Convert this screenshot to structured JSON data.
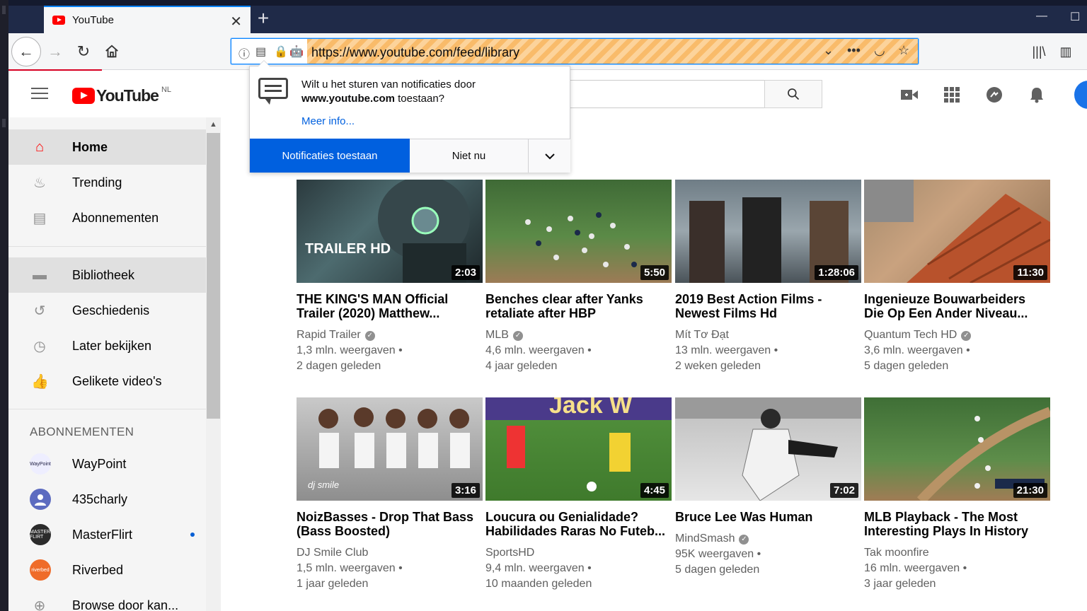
{
  "browser": {
    "tab_title": "YouTube",
    "tab_close": "✕",
    "new_tab": "+",
    "url": "https://www.youtube.com/feed/library",
    "win_min": "—",
    "win_max": "☐"
  },
  "masthead": {
    "logo_text": "YouTube",
    "logo_region": "NL"
  },
  "notification": {
    "line1": "Wilt u het sturen van notificaties door",
    "domain": "www.youtube.com",
    "line2_rest": " toestaan?",
    "more_info": "Meer info...",
    "allow_button": "Notificaties toestaan",
    "deny_button": "Niet nu"
  },
  "sidebar": {
    "items": [
      {
        "label": "Home"
      },
      {
        "label": "Trending"
      },
      {
        "label": "Abonnementen"
      },
      {
        "label": "Bibliotheek"
      },
      {
        "label": "Geschiedenis"
      },
      {
        "label": "Later bekijken"
      },
      {
        "label": "Gelikete video's"
      }
    ],
    "subscriptions_heading": "ABONNEMENTEN",
    "subscriptions": [
      {
        "label": "WayPoint",
        "avatar_text": "WayPoint"
      },
      {
        "label": "435charly",
        "avatar_text": ""
      },
      {
        "label": "MasterFlirt",
        "avatar_text": "MASTER FLIRT"
      },
      {
        "label": "Riverbed",
        "avatar_text": "riverbed"
      },
      {
        "label": "Browse door kan..."
      }
    ]
  },
  "videos": [
    {
      "title1": "THE KING'S MAN Official",
      "title2": "Trailer (2020) Matthew...",
      "channel": "Rapid Trailer",
      "verified": true,
      "views": "1,3 mln. weergaven •",
      "age": "2 dagen geleden",
      "duration": "2:03",
      "thumb_label": "TRAILER HD"
    },
    {
      "title1": "Benches clear after Yanks",
      "title2": "retaliate after HBP",
      "channel": "MLB",
      "verified": true,
      "views": "4,6 mln. weergaven •",
      "age": "4 jaar geleden",
      "duration": "5:50"
    },
    {
      "title1": "2019 Best Action Films -",
      "title2": "Newest Films Hd",
      "channel": "Mít Tơ Đạt",
      "verified": false,
      "views": "13 mln. weergaven •",
      "age": "2 weken geleden",
      "duration": "1:28:06"
    },
    {
      "title1": "Ingenieuze Bouwarbeiders",
      "title2": "Die Op Een Ander Niveau...",
      "channel": "Quantum Tech HD",
      "verified": true,
      "views": "3,6 mln. weergaven •",
      "age": "5 dagen geleden",
      "duration": "11:30"
    },
    {
      "title1": "NoizBasses - Drop That Bass",
      "title2": "(Bass Boosted)",
      "channel": "DJ Smile Club",
      "verified": false,
      "views": "1,5 mln. weergaven •",
      "age": "1 jaar geleden",
      "duration": "3:16",
      "thumb_label": "dj smile"
    },
    {
      "title1": "Loucura ou Genialidade?",
      "title2": "Habilidades Raras No Futeb...",
      "channel": "SportsHD",
      "verified": false,
      "views": "9,4 mln. weergaven •",
      "age": "10 maanden geleden",
      "duration": "4:45",
      "thumb_label": "Jack W"
    },
    {
      "title1": "Bruce Lee Was Human",
      "title2": "",
      "channel": "MindSmash",
      "verified": true,
      "views": "95K weergaven •",
      "age": "5 dagen geleden",
      "duration": "7:02"
    },
    {
      "title1": "MLB Playback - The Most",
      "title2": "Interesting Plays In History",
      "channel": "Tak moonfire",
      "verified": false,
      "views": "16 mln. weergaven •",
      "age": "3 jaar geleden",
      "duration": "21:30"
    }
  ]
}
